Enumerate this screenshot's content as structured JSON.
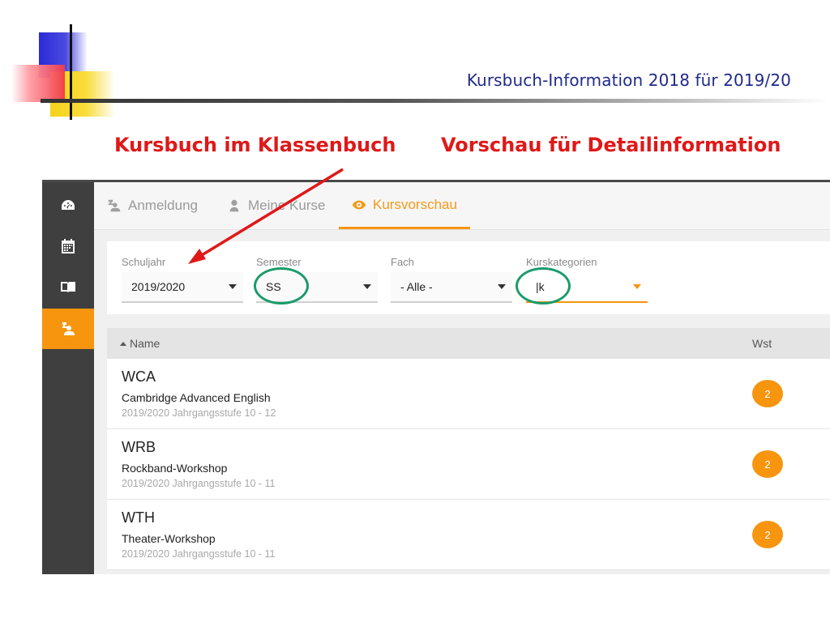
{
  "slide": {
    "title": "Kursbuch-Information 2018 für 2019/20",
    "callout_left": "Kursbuch im Klassenbuch",
    "callout_right": "Vorschau für Detailinformation"
  },
  "sidebar": {
    "items": [
      {
        "icon": "dashboard-icon",
        "active": false
      },
      {
        "icon": "calendar-icon",
        "active": false
      },
      {
        "icon": "book-icon",
        "active": false
      },
      {
        "icon": "course-booking-icon",
        "active": true
      }
    ]
  },
  "tabs": [
    {
      "label": "Anmeldung",
      "icon": "registration-icon",
      "active": false
    },
    {
      "label": "Meine Kurse",
      "icon": "user-icon",
      "active": false
    },
    {
      "label": "Kursvorschau",
      "icon": "eye-icon",
      "active": true
    }
  ],
  "filters": {
    "schuljahr": {
      "label": "Schuljahr",
      "value": "2019/2020"
    },
    "semester": {
      "label": "Semester",
      "value": "SS"
    },
    "fach": {
      "label": "Fach",
      "value": "- Alle -"
    },
    "kurskategorien": {
      "label": "Kurskategorien",
      "value": "|k"
    }
  },
  "table": {
    "columns": {
      "name": "Name",
      "wst": "Wst"
    },
    "rows": [
      {
        "code": "WCA",
        "title": "Cambridge Advanced English",
        "meta": "2019/2020  Jahrgangsstufe 10 - 12",
        "wst": "2"
      },
      {
        "code": "WRB",
        "title": "Rockband-Workshop",
        "meta": "2019/2020  Jahrgangsstufe 10 - 11",
        "wst": "2"
      },
      {
        "code": "WTH",
        "title": "Theater-Workshop",
        "meta": "2019/2020  Jahrgangsstufe 10 - 11",
        "wst": "2"
      }
    ]
  },
  "colors": {
    "accent": "#f7950f",
    "sidebar": "#3f3f3f",
    "callout": "#e01818",
    "title": "#1f2a8a",
    "annotation_ring": "#1b9b6b"
  }
}
